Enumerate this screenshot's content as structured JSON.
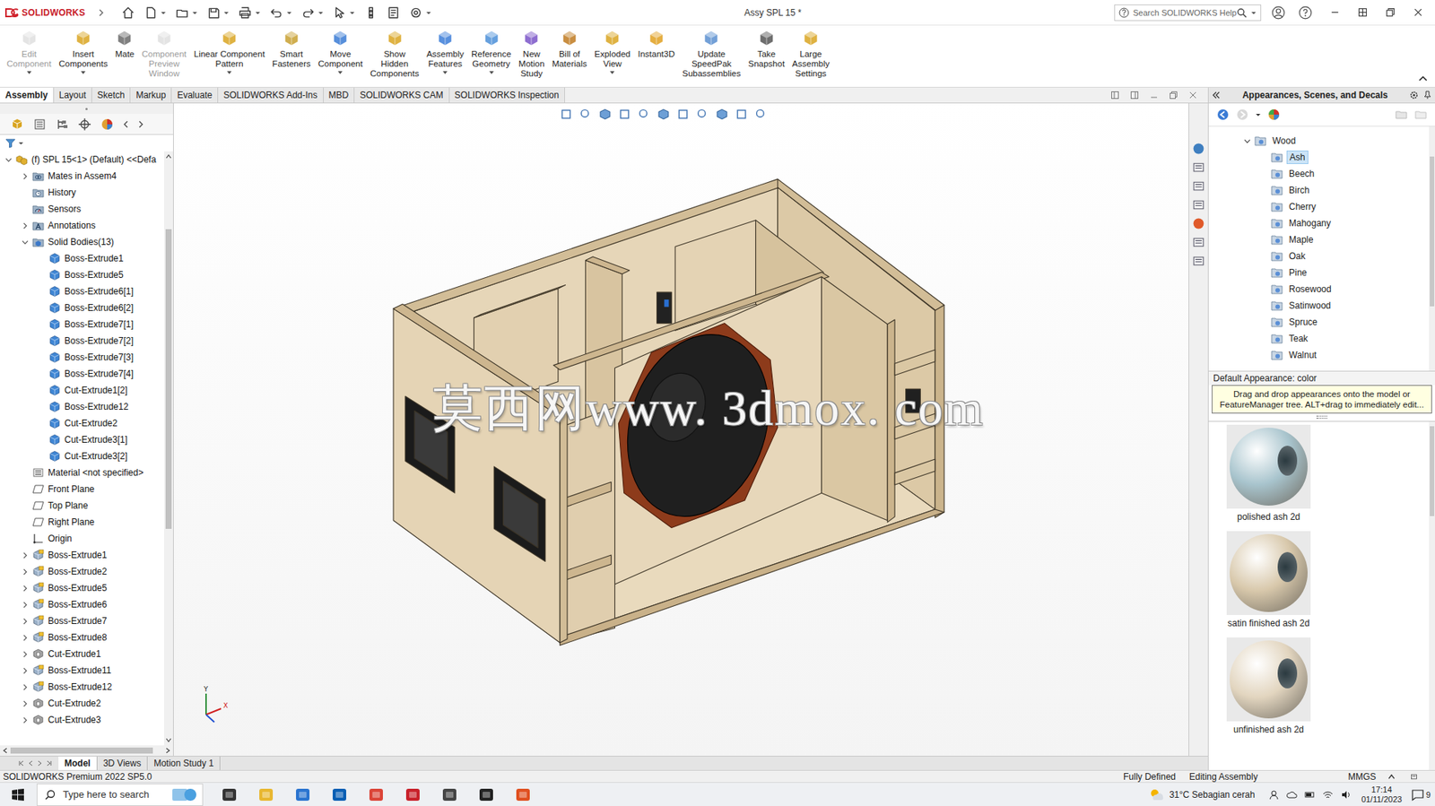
{
  "app": {
    "logo": "SOLIDWORKS",
    "title": "Assy SPL 15 *",
    "search_placeholder": "Search SOLIDWORKS Help"
  },
  "ribbon": [
    {
      "lines": [
        "Edit",
        "Component"
      ],
      "disabled": true,
      "dropdown": true
    },
    {
      "lines": [
        "Insert",
        "Components"
      ],
      "disabled": false,
      "dropdown": true
    },
    {
      "lines": [
        "Mate"
      ],
      "disabled": false,
      "dropdown": false
    },
    {
      "lines": [
        "Component",
        "Preview",
        "Window"
      ],
      "disabled": true,
      "dropdown": false
    },
    {
      "lines": [
        "Linear Component",
        "Pattern"
      ],
      "disabled": false,
      "dropdown": true
    },
    {
      "lines": [
        "Smart",
        "Fasteners"
      ],
      "disabled": false,
      "dropdown": false
    },
    {
      "lines": [
        "Move",
        "Component"
      ],
      "disabled": false,
      "dropdown": true
    },
    {
      "lines": [
        "Show",
        "Hidden",
        "Components"
      ],
      "disabled": false,
      "dropdown": false
    },
    {
      "lines": [
        "Assembly",
        "Features"
      ],
      "disabled": false,
      "dropdown": true
    },
    {
      "lines": [
        "Reference",
        "Geometry"
      ],
      "disabled": false,
      "dropdown": true
    },
    {
      "lines": [
        "New",
        "Motion",
        "Study"
      ],
      "disabled": false,
      "dropdown": false
    },
    {
      "lines": [
        "Bill of",
        "Materials"
      ],
      "disabled": false,
      "dropdown": false
    },
    {
      "lines": [
        "Exploded",
        "View"
      ],
      "disabled": false,
      "dropdown": true
    },
    {
      "lines": [
        "Instant3D"
      ],
      "disabled": false,
      "dropdown": false
    },
    {
      "lines": [
        "Update",
        "SpeedPak",
        "Subassemblies"
      ],
      "disabled": false,
      "dropdown": false
    },
    {
      "lines": [
        "Take",
        "Snapshot"
      ],
      "disabled": false,
      "dropdown": false
    },
    {
      "lines": [
        "Large",
        "Assembly",
        "Settings"
      ],
      "disabled": false,
      "dropdown": false
    }
  ],
  "tabs": [
    {
      "label": "Assembly",
      "selected": true
    },
    {
      "label": "Layout",
      "selected": false
    },
    {
      "label": "Sketch",
      "selected": false
    },
    {
      "label": "Markup",
      "selected": false
    },
    {
      "label": "Evaluate",
      "selected": false
    },
    {
      "label": "SOLIDWORKS Add-Ins",
      "selected": false
    },
    {
      "label": "MBD",
      "selected": false
    },
    {
      "label": "SOLIDWORKS CAM",
      "selected": false
    },
    {
      "label": "SOLIDWORKS Inspection",
      "selected": false
    }
  ],
  "feature_tree": {
    "items": [
      {
        "label": "(f) SPL 15<1> (Default) <<Defa",
        "level": 0,
        "kind": "part",
        "expandable": true,
        "expanded": true
      },
      {
        "label": "Mates in Assem4",
        "level": 1,
        "kind": "mates",
        "expandable": true,
        "expanded": false
      },
      {
        "label": "History",
        "level": 1,
        "kind": "history",
        "expandable": false,
        "expanded": false
      },
      {
        "label": "Sensors",
        "level": 1,
        "kind": "sensors",
        "expandable": false,
        "expanded": false
      },
      {
        "label": "Annotations",
        "level": 1,
        "kind": "annotations",
        "expandable": true,
        "expanded": false
      },
      {
        "label": "Solid Bodies(13)",
        "level": 1,
        "kind": "bodies",
        "expandable": true,
        "expanded": true
      },
      {
        "label": "Boss-Extrude1",
        "level": 2,
        "kind": "body",
        "expandable": false,
        "expanded": false
      },
      {
        "label": "Boss-Extrude5",
        "level": 2,
        "kind": "body",
        "expandable": false,
        "expanded": false
      },
      {
        "label": "Boss-Extrude6[1]",
        "level": 2,
        "kind": "body",
        "expandable": false,
        "expanded": false
      },
      {
        "label": "Boss-Extrude6[2]",
        "level": 2,
        "kind": "body",
        "expandable": false,
        "expanded": false
      },
      {
        "label": "Boss-Extrude7[1]",
        "level": 2,
        "kind": "body",
        "expandable": false,
        "expanded": false
      },
      {
        "label": "Boss-Extrude7[2]",
        "level": 2,
        "kind": "body",
        "expandable": false,
        "expanded": false
      },
      {
        "label": "Boss-Extrude7[3]",
        "level": 2,
        "kind": "body",
        "expandable": false,
        "expanded": false
      },
      {
        "label": "Boss-Extrude7[4]",
        "level": 2,
        "kind": "body",
        "expandable": false,
        "expanded": false
      },
      {
        "label": "Cut-Extrude1[2]",
        "level": 2,
        "kind": "body",
        "expandable": false,
        "expanded": false
      },
      {
        "label": "Boss-Extrude12",
        "level": 2,
        "kind": "body",
        "expandable": false,
        "expanded": false
      },
      {
        "label": "Cut-Extrude2",
        "level": 2,
        "kind": "body",
        "expandable": false,
        "expanded": false
      },
      {
        "label": "Cut-Extrude3[1]",
        "level": 2,
        "kind": "body",
        "expandable": false,
        "expanded": false
      },
      {
        "label": "Cut-Extrude3[2]",
        "level": 2,
        "kind": "body",
        "expandable": false,
        "expanded": false
      },
      {
        "label": "Material <not specified>",
        "level": 1,
        "kind": "material",
        "expandable": false,
        "expanded": false
      },
      {
        "label": "Front Plane",
        "level": 1,
        "kind": "plane",
        "expandable": false,
        "expanded": false
      },
      {
        "label": "Top Plane",
        "level": 1,
        "kind": "plane",
        "expandable": false,
        "expanded": false
      },
      {
        "label": "Right Plane",
        "level": 1,
        "kind": "plane",
        "expandable": false,
        "expanded": false
      },
      {
        "label": "Origin",
        "level": 1,
        "kind": "origin",
        "expandable": false,
        "expanded": false
      },
      {
        "label": "Boss-Extrude1",
        "level": 1,
        "kind": "feature",
        "expandable": true,
        "expanded": false
      },
      {
        "label": "Boss-Extrude2",
        "level": 1,
        "kind": "feature",
        "expandable": true,
        "expanded": false
      },
      {
        "label": "Boss-Extrude5",
        "level": 1,
        "kind": "feature",
        "expandable": true,
        "expanded": false
      },
      {
        "label": "Boss-Extrude6",
        "level": 1,
        "kind": "feature",
        "expandable": true,
        "expanded": false
      },
      {
        "label": "Boss-Extrude7",
        "level": 1,
        "kind": "feature",
        "expandable": true,
        "expanded": false
      },
      {
        "label": "Boss-Extrude8",
        "level": 1,
        "kind": "feature",
        "expandable": true,
        "expanded": false
      },
      {
        "label": "Cut-Extrude1",
        "level": 1,
        "kind": "cut",
        "expandable": true,
        "expanded": false
      },
      {
        "label": "Boss-Extrude11",
        "level": 1,
        "kind": "feature",
        "expandable": true,
        "expanded": false
      },
      {
        "label": "Boss-Extrude12",
        "level": 1,
        "kind": "feature",
        "expandable": true,
        "expanded": false
      },
      {
        "label": "Cut-Extrude2",
        "level": 1,
        "kind": "cut",
        "expandable": true,
        "expanded": false
      },
      {
        "label": "Cut-Extrude3",
        "level": 1,
        "kind": "cut",
        "expandable": true,
        "expanded": false
      }
    ]
  },
  "viewport": {
    "watermark": "莫西网www. 3dmox. com",
    "triad_labels": [
      "Y",
      "X"
    ]
  },
  "task_pane": {
    "title": "Appearances, Scenes, and Decals",
    "tree": [
      {
        "label": "Wood",
        "level": 0,
        "expandable": true,
        "expanded": true,
        "selected": false
      },
      {
        "label": "Ash",
        "level": 1,
        "expandable": false,
        "expanded": false,
        "selected": true
      },
      {
        "label": "Beech",
        "level": 1,
        "expandable": false,
        "expanded": false,
        "selected": false
      },
      {
        "label": "Birch",
        "level": 1,
        "expandable": false,
        "expanded": false,
        "selected": false
      },
      {
        "label": "Cherry",
        "level": 1,
        "expandable": false,
        "expanded": false,
        "selected": false
      },
      {
        "label": "Mahogany",
        "level": 1,
        "expandable": false,
        "expanded": false,
        "selected": false
      },
      {
        "label": "Maple",
        "level": 1,
        "expandable": false,
        "expanded": false,
        "selected": false
      },
      {
        "label": "Oak",
        "level": 1,
        "expandable": false,
        "expanded": false,
        "selected": false
      },
      {
        "label": "Pine",
        "level": 1,
        "expandable": false,
        "expanded": false,
        "selected": false
      },
      {
        "label": "Rosewood",
        "level": 1,
        "expandable": false,
        "expanded": false,
        "selected": false
      },
      {
        "label": "Satinwood",
        "level": 1,
        "expandable": false,
        "expanded": false,
        "selected": false
      },
      {
        "label": "Spruce",
        "level": 1,
        "expandable": false,
        "expanded": false,
        "selected": false
      },
      {
        "label": "Teak",
        "level": 1,
        "expandable": false,
        "expanded": false,
        "selected": false
      },
      {
        "label": "Walnut",
        "level": 1,
        "expandable": false,
        "expanded": false,
        "selected": false
      }
    ],
    "default_appearance": "Default Appearance: color",
    "tooltip": "Drag and drop appearances onto the model or FeatureManager tree.  ALT+drag to immediately edit...",
    "swatches": [
      {
        "label": "polished ash 2d",
        "color": "#a8c4cd"
      },
      {
        "label": "satin finished ash 2d",
        "color": "#d8c8ab"
      },
      {
        "label": "unfinished ash 2d",
        "color": "#e2d5bf"
      }
    ]
  },
  "bottom_tabs": [
    {
      "label": "Model",
      "selected": true
    },
    {
      "label": "3D Views",
      "selected": false
    },
    {
      "label": "Motion Study 1",
      "selected": false
    }
  ],
  "status_bar": {
    "product": "SOLIDWORKS Premium 2022 SP5.0",
    "state": "Fully Defined",
    "mode": "Editing Assembly",
    "units": "MMGS"
  },
  "taskbar": {
    "search_placeholder": "Type here to search",
    "weather": "31°C Sebagian cerah",
    "time": "17:14",
    "date": "01/11/2023",
    "notifications": "9"
  }
}
